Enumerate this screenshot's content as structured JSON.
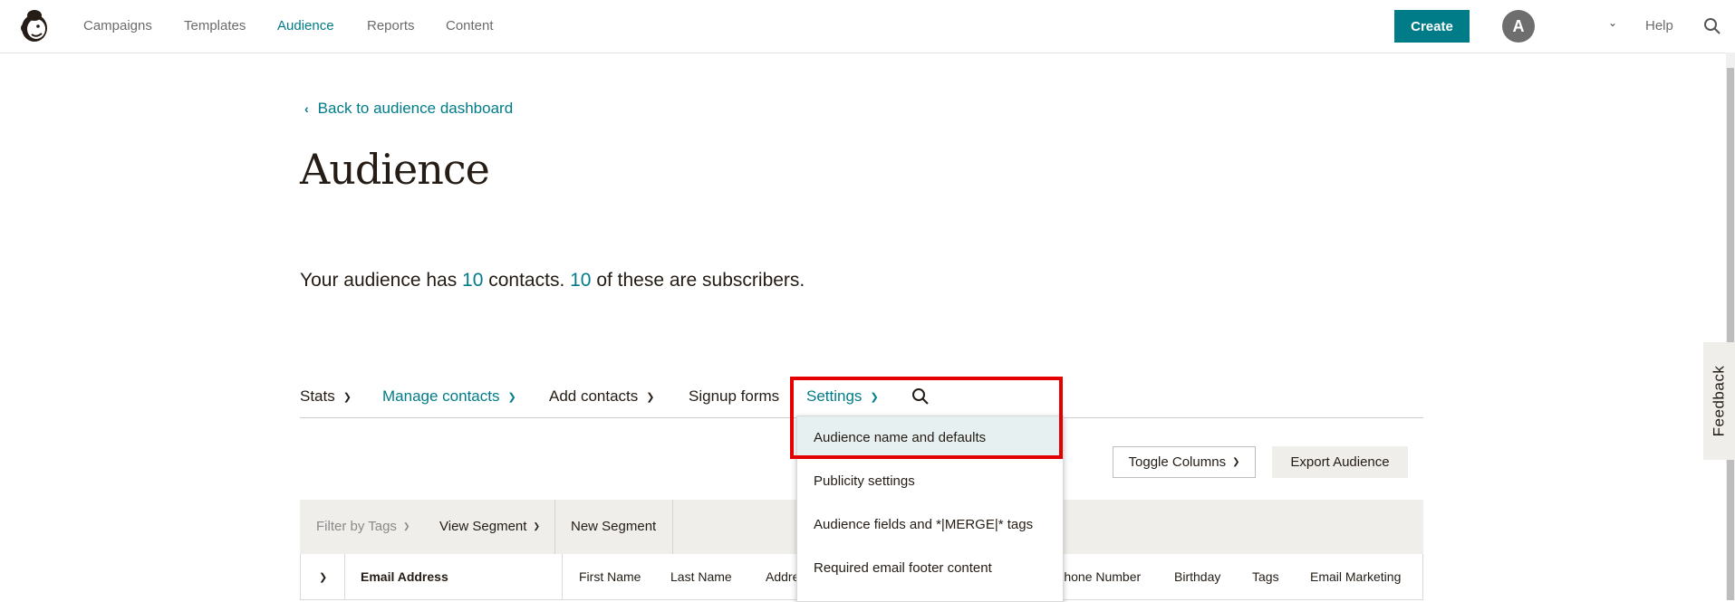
{
  "nav": {
    "items": [
      "Campaigns",
      "Templates",
      "Audience",
      "Reports",
      "Content"
    ],
    "create_label": "Create",
    "avatar_initial": "A",
    "help_label": "Help"
  },
  "feedback_label": "Feedback",
  "back_label": "Back to audience dashboard",
  "page_title": "Audience",
  "summary": {
    "prefix": "Your audience has ",
    "contacts": "10",
    "mid": " contacts. ",
    "subscribers": "10",
    "suffix": " of these are subscribers."
  },
  "subnav": {
    "stats": "Stats",
    "manage": "Manage contacts",
    "add": "Add contacts",
    "signup": "Signup forms",
    "settings": "Settings"
  },
  "settings_menu": [
    "Audience name and defaults",
    "Publicity settings",
    "Audience fields and *|MERGE|* tags",
    "Required email footer content"
  ],
  "toggle_columns_label": "Toggle Columns",
  "export_label": "Export Audience",
  "filters": {
    "tags": "Filter by Tags",
    "view_segment": "View Segment",
    "new_segment": "New Segment"
  },
  "columns": [
    "Email Address",
    "First Name",
    "Last Name",
    "Address",
    "Phone Number",
    "Birthday",
    "Tags",
    "Email Marketing"
  ],
  "colors": {
    "accent": "#007c89",
    "highlight": "#e40000",
    "panel": "#efeeea"
  }
}
